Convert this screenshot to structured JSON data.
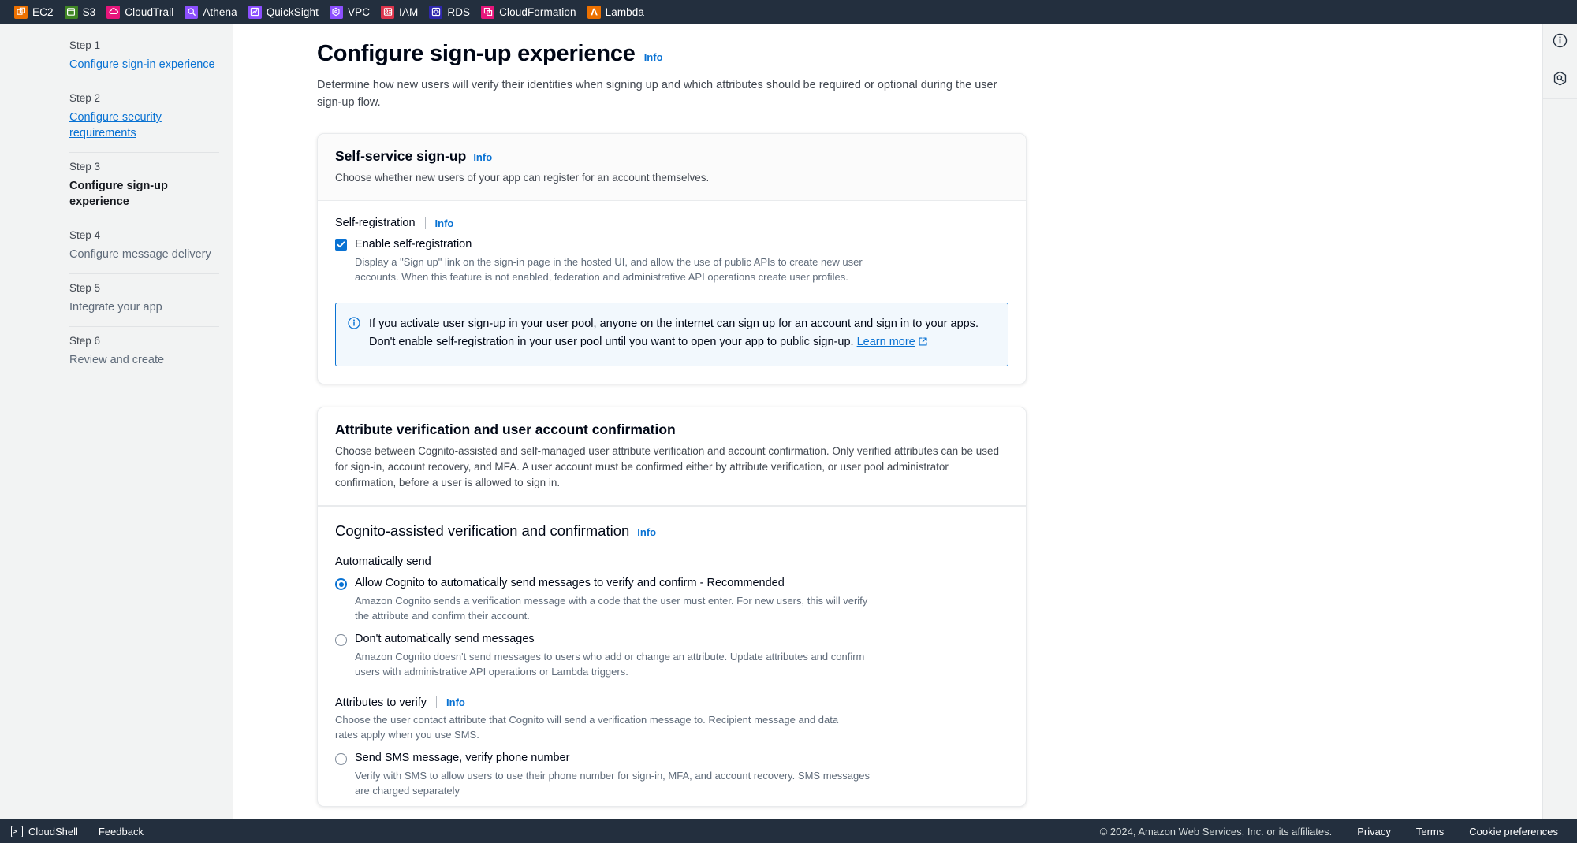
{
  "topbar": {
    "services": [
      {
        "label": "EC2",
        "icon": "ec2-icon",
        "color": "#ed7100"
      },
      {
        "label": "S3",
        "icon": "s3-icon",
        "color": "#3f8624"
      },
      {
        "label": "CloudTrail",
        "icon": "cloudtrail-icon",
        "color": "#e7157b"
      },
      {
        "label": "Athena",
        "icon": "athena-icon",
        "color": "#8c4fff"
      },
      {
        "label": "QuickSight",
        "icon": "quicksight-icon",
        "color": "#8c4fff"
      },
      {
        "label": "VPC",
        "icon": "vpc-icon",
        "color": "#8c4fff"
      },
      {
        "label": "IAM",
        "icon": "iam-icon",
        "color": "#dd344c"
      },
      {
        "label": "RDS",
        "icon": "rds-icon",
        "color": "#2e27ad"
      },
      {
        "label": "CloudFormation",
        "icon": "cloudformation-icon",
        "color": "#e7157b"
      },
      {
        "label": "Lambda",
        "icon": "lambda-icon",
        "color": "#ed7100"
      }
    ]
  },
  "sidebar": {
    "steps": [
      {
        "num": "Step 1",
        "label": "Configure sign-in experience",
        "state": "link"
      },
      {
        "num": "Step 2",
        "label": "Configure security requirements",
        "state": "link"
      },
      {
        "num": "Step 3",
        "label": "Configure sign-up experience",
        "state": "current"
      },
      {
        "num": "Step 4",
        "label": "Configure message delivery",
        "state": "plain"
      },
      {
        "num": "Step 5",
        "label": "Integrate your app",
        "state": "plain"
      },
      {
        "num": "Step 6",
        "label": "Review and create",
        "state": "plain"
      }
    ]
  },
  "page": {
    "title": "Configure sign-up experience",
    "info_label": "Info",
    "description": "Determine how new users will verify their identities when signing up and which attributes should be required or optional during the user sign-up flow."
  },
  "self_service": {
    "title": "Self-service sign-up",
    "info_label": "Info",
    "subtitle": "Choose whether new users of your app can register for an account themselves.",
    "field_label": "Self-registration",
    "field_info_label": "Info",
    "checkbox_label": "Enable self-registration",
    "checkbox_checked": true,
    "checkbox_desc": "Display a \"Sign up\" link on the sign-in page in the hosted UI, and allow the use of public APIs to create new user accounts. When this feature is not enabled, federation and administrative API operations create user profiles.",
    "alert_text": "If you activate user sign-up in your user pool, anyone on the internet can sign up for an account and sign in to your apps. Don't enable self-registration in your user pool until you want to open your app to public sign-up. ",
    "alert_link": "Learn more"
  },
  "attribute_verification": {
    "title": "Attribute verification and user account confirmation",
    "subtitle": "Choose between Cognito-assisted and self-managed user attribute verification and account confirmation. Only verified attributes can be used for sign-in, account recovery, and MFA. A user account must be confirmed either by attribute verification, or user pool administrator confirmation, before a user is allowed to sign in.",
    "section_title": "Cognito-assisted verification and confirmation",
    "section_info_label": "Info",
    "auto_send_label": "Automatically send",
    "auto_send_options": [
      {
        "label": "Allow Cognito to automatically send messages to verify and confirm - Recommended",
        "desc": "Amazon Cognito sends a verification message with a code that the user must enter. For new users, this will verify the attribute and confirm their account.",
        "selected": true
      },
      {
        "label": "Don't automatically send messages",
        "desc": "Amazon Cognito doesn't send messages to users who add or change an attribute. Update attributes and confirm users with administrative API operations or Lambda triggers.",
        "selected": false
      }
    ],
    "attributes_label": "Attributes to verify",
    "attributes_info_label": "Info",
    "attributes_desc": "Choose the user contact attribute that Cognito will send a verification message to. Recipient message and data rates apply when you use SMS.",
    "attributes_options": [
      {
        "label": "Send SMS message, verify phone number",
        "desc": "Verify with SMS to allow users to use their phone number for sign-in, MFA, and account recovery. SMS messages are charged separately",
        "selected": false
      }
    ]
  },
  "rightrail": {
    "buttons": [
      {
        "icon": "info-circle-icon"
      },
      {
        "icon": "security-shield-icon"
      }
    ]
  },
  "bottombar": {
    "cloudshell_label": "CloudShell",
    "feedback_label": "Feedback",
    "copyright": "© 2024, Amazon Web Services, Inc. or its affiliates.",
    "links": [
      "Privacy",
      "Terms",
      "Cookie preferences"
    ]
  },
  "colors": {
    "aws_navy": "#232f3e",
    "link_blue": "#0972d3",
    "alert_bg": "#f2f8fd"
  }
}
